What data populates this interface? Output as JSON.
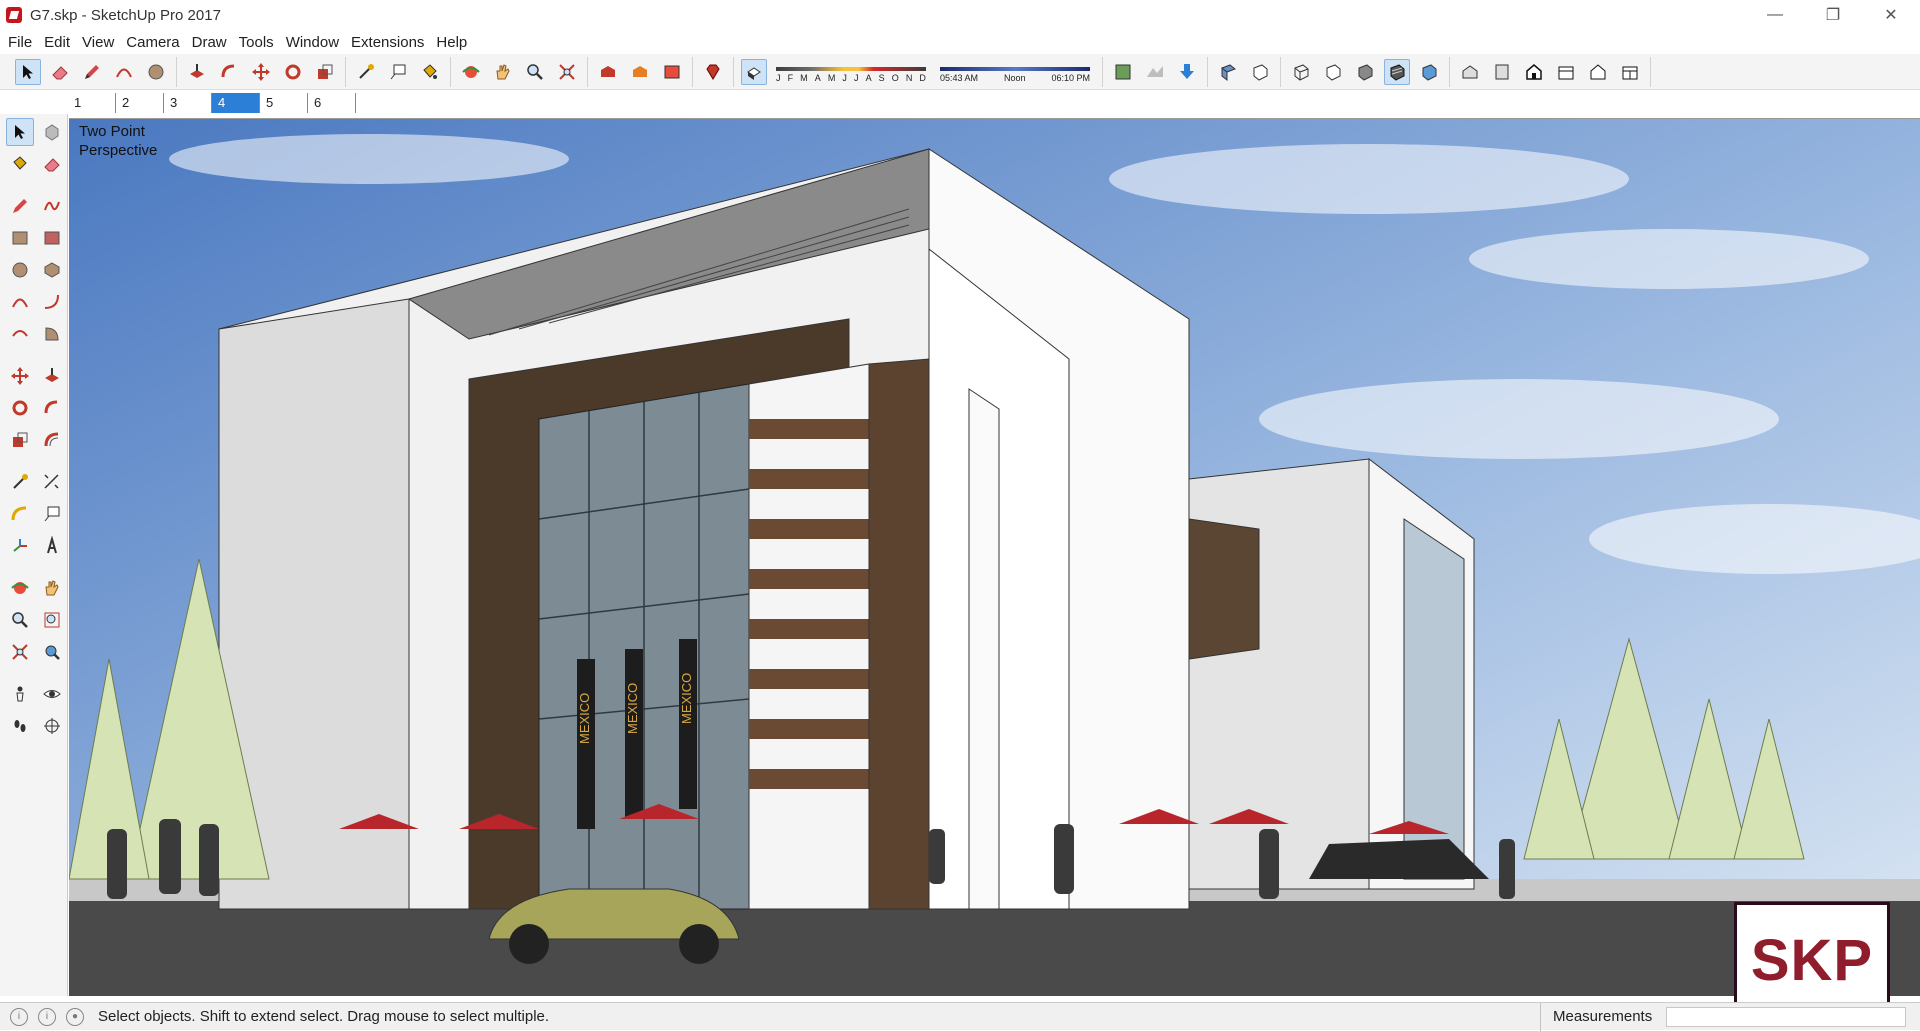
{
  "window": {
    "title": "G7.skp - SketchUp Pro 2017",
    "controls": {
      "minimize": "—",
      "maximize": "❐",
      "close": "✕"
    }
  },
  "menu": [
    "File",
    "Edit",
    "View",
    "Camera",
    "Draw",
    "Tools",
    "Window",
    "Extensions",
    "Help"
  ],
  "shadow_settings": {
    "months": [
      "J",
      "F",
      "M",
      "A",
      "M",
      "J",
      "J",
      "A",
      "S",
      "O",
      "N",
      "D"
    ],
    "time_start": "05:43 AM",
    "time_mid": "Noon",
    "time_end": "06:10 PM"
  },
  "scene_tabs": [
    {
      "label": "1",
      "active": false
    },
    {
      "label": "2",
      "active": false
    },
    {
      "label": "3",
      "active": false
    },
    {
      "label": "4",
      "active": true
    },
    {
      "label": "5",
      "active": false
    },
    {
      "label": "6",
      "active": false
    }
  ],
  "viewport": {
    "camera_label_line1": "Two Point",
    "camera_label_line2": "Perspective",
    "banner_text": "MEXICO"
  },
  "badge": {
    "text": "SKP"
  },
  "status": {
    "message": "Select objects. Shift to extend select. Drag mouse to select multiple.",
    "measurements_label": "Measurements",
    "measurements_value": ""
  },
  "colors": {
    "accent": "#2b7fd7",
    "brand_red": "#c4161c",
    "badge_red": "#8f1d2b"
  }
}
